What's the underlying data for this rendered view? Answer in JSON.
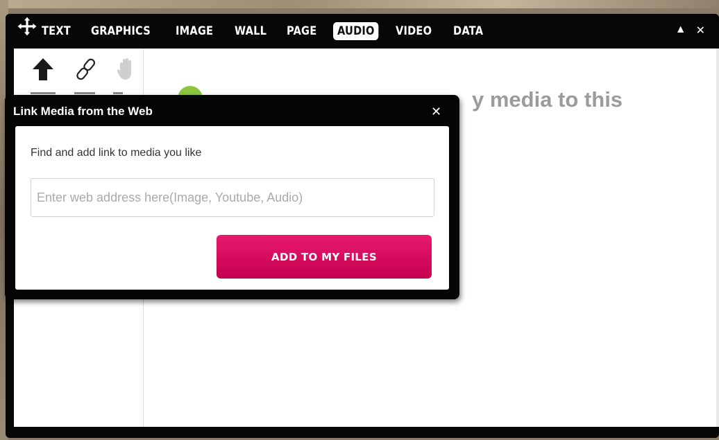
{
  "toolbar": {
    "tabs": [
      {
        "label": "TEXT",
        "active": false
      },
      {
        "label": "GRAPHICS",
        "active": false
      },
      {
        "label": "IMAGE",
        "active": false
      },
      {
        "label": "WALL",
        "active": false
      },
      {
        "label": "PAGE",
        "active": false
      },
      {
        "label": "AUDIO",
        "active": true
      },
      {
        "label": "VIDEO",
        "active": false
      },
      {
        "label": "DATA",
        "active": false
      }
    ],
    "minimize_glyph": "▲",
    "close_glyph": "✕"
  },
  "main": {
    "info_text": "y media to this",
    "tool_icons": [
      "upload-arrow-icon",
      "link-icon",
      "hand-icon"
    ]
  },
  "dialog": {
    "title": "Link Media from the Web",
    "close_glyph": "✕",
    "prompt": "Find and add link to media you like",
    "url_input": {
      "value": "",
      "placeholder": "Enter web address here(Image, Youtube, Audio)"
    },
    "add_button_label": "ADD TO MY FILES"
  },
  "colors": {
    "accent_button": "#d6005c",
    "info_icon": "#8cc63f",
    "panel": "#070707"
  }
}
